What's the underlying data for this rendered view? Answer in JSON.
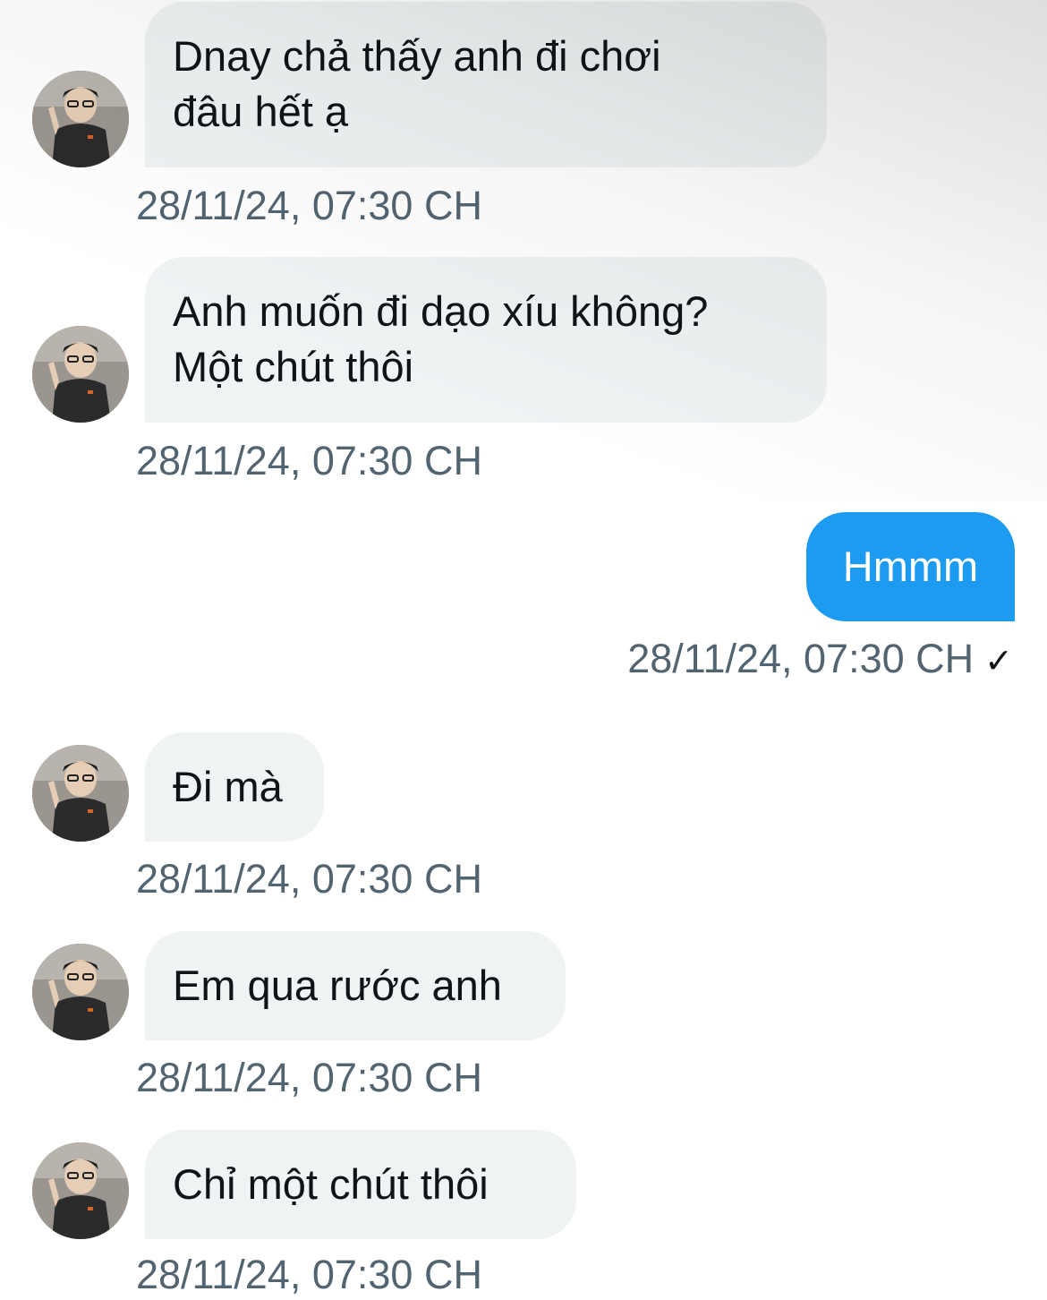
{
  "conversation": {
    "messages": [
      {
        "direction": "incoming",
        "lines": [
          "Dnay chả thấy anh đi chơi",
          "đâu hết ạ"
        ],
        "timestamp": "28/11/24, 07:30 CH"
      },
      {
        "direction": "incoming",
        "lines": [
          "Anh muốn đi dạo xíu không?",
          "Một chút thôi"
        ],
        "timestamp": "28/11/24, 07:30 CH"
      },
      {
        "direction": "outgoing",
        "lines": [
          "Hmmm"
        ],
        "timestamp": "28/11/24, 07:30 CH",
        "status_icon": "checkmark-icon",
        "status_glyph": "✓"
      },
      {
        "direction": "incoming",
        "lines": [
          "Đi mà"
        ],
        "timestamp": "28/11/24, 07:30 CH"
      },
      {
        "direction": "incoming",
        "lines": [
          "Em qua rước anh"
        ],
        "timestamp": "28/11/24, 07:30 CH"
      },
      {
        "direction": "incoming",
        "lines": [
          "Chỉ một chút thôi"
        ],
        "timestamp": "28/11/24, 07:30 CH"
      }
    ]
  },
  "colors": {
    "incoming_bubble": "#eff3f4",
    "outgoing_bubble": "#1d9bf0",
    "timestamp": "#536471",
    "text": "#0f1419"
  }
}
